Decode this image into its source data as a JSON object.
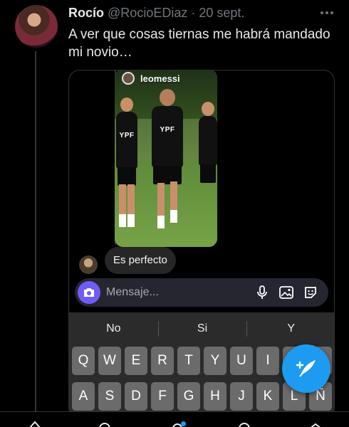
{
  "tweet": {
    "name": "Rocío",
    "handle": "@RocioEDiaz",
    "separator": "·",
    "date": "20 sept.",
    "text": "A ver que cosas tiernas me habrá mandado mi novio…",
    "more_icon": "more-horizontal-icon"
  },
  "dm": {
    "story_user": "leomessi",
    "shirt_sponsor": "YPF",
    "reply_text": "Es perfecto",
    "compose_placeholder": "Mensaje...",
    "icons": [
      "camera-icon",
      "microphone-icon",
      "image-icon",
      "sticker-icon"
    ],
    "accent": "#6f5cf7"
  },
  "keyboard": {
    "suggestions": [
      "No",
      "Si",
      "Y"
    ],
    "row1": [
      "Q",
      "W",
      "E",
      "R",
      "T",
      "Y",
      "U",
      "I",
      "O",
      "P"
    ],
    "row2": [
      "A",
      "S",
      "D",
      "F",
      "G",
      "H",
      "J",
      "K",
      "L",
      "Ñ"
    ]
  },
  "compose_button": {
    "icon": "compose-tweet-icon",
    "color": "#1d9bf0"
  },
  "tabs": [
    "home-icon",
    "search-icon",
    "spaces-icon",
    "notifications-icon",
    "messages-icon"
  ]
}
